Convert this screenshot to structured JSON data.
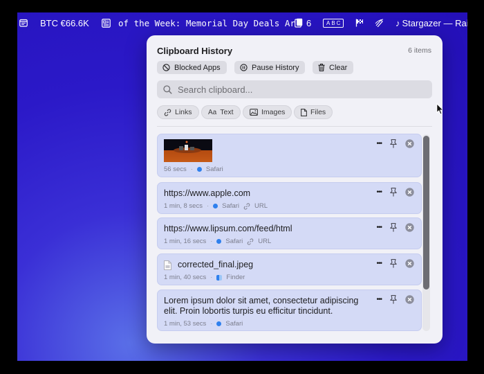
{
  "menubar": {
    "crypto": "BTC €66.6K",
    "headline": "of the Week: Memorial Day Deals Ar",
    "clipboard_count": "6",
    "input_source": "ABC",
    "now_playing": "Stargazer — Rai"
  },
  "panel": {
    "title": "Clipboard History",
    "count": "6 items",
    "toolbar": {
      "blocked_apps": "Blocked Apps",
      "pause_history": "Pause History",
      "clear": "Clear"
    },
    "search_placeholder": "Search clipboard...",
    "filters": [
      "Links",
      "Text",
      "Images",
      "Files"
    ],
    "items": [
      {
        "type": "image",
        "time": "56 secs",
        "app": "Safari"
      },
      {
        "type": "url",
        "text": "https://www.apple.com",
        "time": "1 min, 8 secs",
        "app": "Safari",
        "kind": "URL"
      },
      {
        "type": "url",
        "text": "https://www.lipsum.com/feed/html",
        "time": "1 min, 16 secs",
        "app": "Safari",
        "kind": "URL"
      },
      {
        "type": "file",
        "text": "corrected_final.jpeg",
        "time": "1 min, 40 secs",
        "app": "Finder"
      },
      {
        "type": "text",
        "text": "Lorem ipsum dolor sit amet, consectetur adipiscing elit. Proin lobortis turpis eu efficitur tincidunt.",
        "time": "1 min, 53 secs",
        "app": "Safari"
      }
    ],
    "more_label": "•••"
  }
}
